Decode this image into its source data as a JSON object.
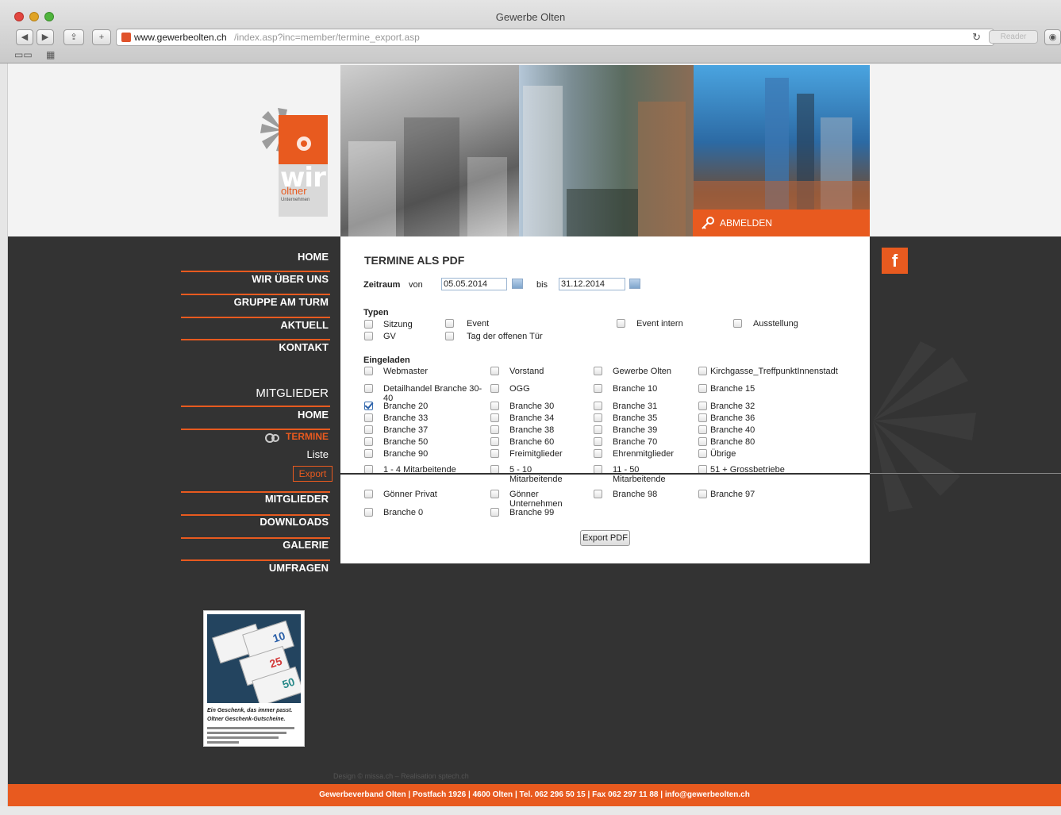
{
  "window": {
    "title": "Gewerbe Olten",
    "url_host": "www.gewerbeolten.ch",
    "url_path": "/index.asp?inc=member/termine_export.asp",
    "reader_label": "Reader",
    "reload_icon": "reload-icon",
    "traffic_colors": [
      "#e2463f",
      "#e0a426",
      "#4fb43c"
    ]
  },
  "header": {
    "logo_text": "wir",
    "logo_sub": "oltner",
    "logo_sub2": "Unternehmen",
    "logout_label": "ABMELDEN"
  },
  "nav": {
    "main": [
      "HOME",
      "WIR ÜBER UNS",
      "GRUPPE AM TURM",
      "AKTUELL",
      "KONTAKT"
    ],
    "members_heading": "MITGLIEDER",
    "members_home": "HOME",
    "termine": "TERMINE",
    "liste": "Liste",
    "export": "Export",
    "secondary": [
      "MITGLIEDER",
      "DOWNLOADS",
      "GALERIE",
      "UMFRAGEN"
    ]
  },
  "ad": {
    "line1": "Ein Geschenk, das immer passt.",
    "line2": "Oltner Geschenk-Gutscheine.",
    "voucher_values": [
      "10",
      "25",
      "50"
    ]
  },
  "form": {
    "title": "TERMINE ALS PDF",
    "period_label": "Zeitraum",
    "from_label": "von",
    "from_value": "05.05.2014",
    "to_label": "bis",
    "to_value": "31.12.2014",
    "types_heading": "Typen",
    "types": [
      "Sitzung",
      "Event",
      "Event intern",
      "Ausstellung",
      "GV",
      "Tag der offenen Tür"
    ],
    "invited_heading": "Eingeladen",
    "invited": [
      "Webmaster",
      "Vorstand",
      "Gewerbe Olten",
      "Kirchgasse_TreffpunktInnenstadt",
      "Detailhandel Branche 30-40",
      "OGG",
      "Branche 10",
      "Branche 15",
      "Branche 20",
      "Branche 30",
      "Branche 31",
      "Branche 32",
      "Branche 33",
      "Branche 34",
      "Branche 35",
      "Branche 36",
      "Branche 37",
      "Branche 38",
      "Branche 39",
      "Branche 40",
      "Branche 50",
      "Branche 60",
      "Branche 70",
      "Branche 80",
      "Branche 90",
      "Freimitglieder",
      "Ehrenmitglieder",
      "Übrige",
      "1 - 4 Mitarbeitende",
      "5 - 10 Mitarbeitende",
      "11 - 50 Mitarbeitende",
      "51 + Grossbetriebe",
      "Gönner Privat",
      "Gönner Unternehmen",
      "Branche 98",
      "Branche 97",
      "Branche 0",
      "Branche 99"
    ],
    "checked": "Branche 20",
    "export_button": "Export PDF"
  },
  "social": {
    "facebook_label": "f"
  },
  "footer": {
    "copyright": "Design © missa.ch – Realisation sptech.ch",
    "text": "Gewerbeverband Olten | Postfach 1926 | 4600 Olten | Tel. 062 296 50 15 | Fax 062 297 11 88 | info@gewerbeolten.ch"
  },
  "colors": {
    "accent": "#e85a1f",
    "dark": "#333333"
  }
}
